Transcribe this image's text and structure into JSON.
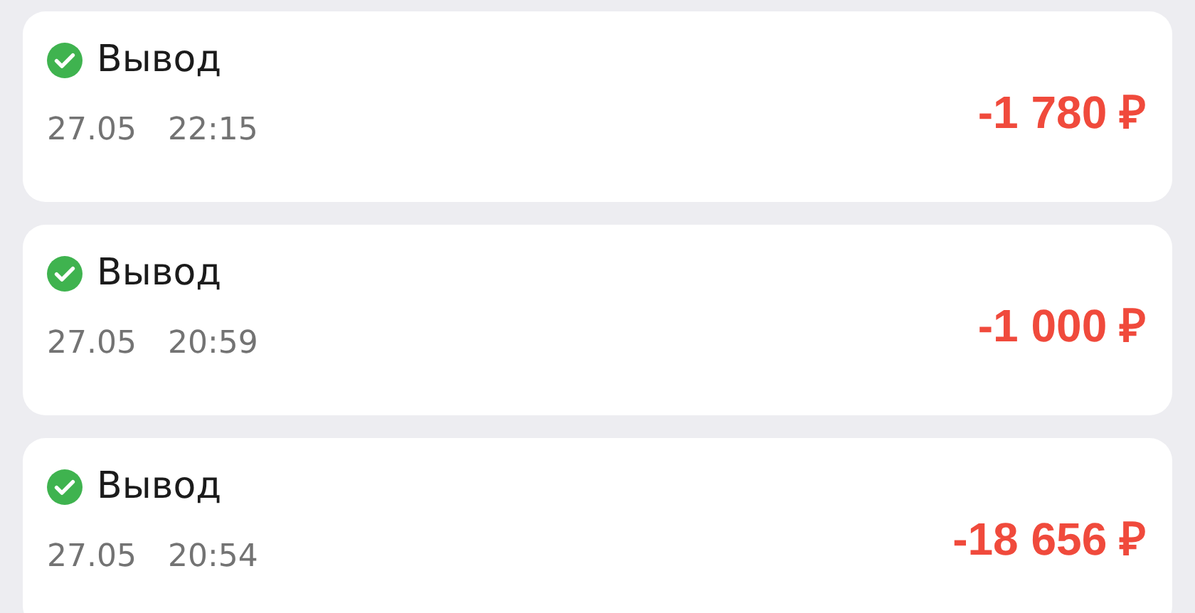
{
  "transactions": [
    {
      "completed": true,
      "title": "Вывод",
      "date": "27.05",
      "time": "22:15",
      "amount": "-1 780 ₽"
    },
    {
      "completed": true,
      "title": "Вывод",
      "date": "27.05",
      "time": "20:59",
      "amount": "-1 000 ₽"
    },
    {
      "completed": true,
      "title": "Вывод",
      "date": "27.05",
      "time": "20:54",
      "amount": "-18 656 ₽"
    }
  ]
}
